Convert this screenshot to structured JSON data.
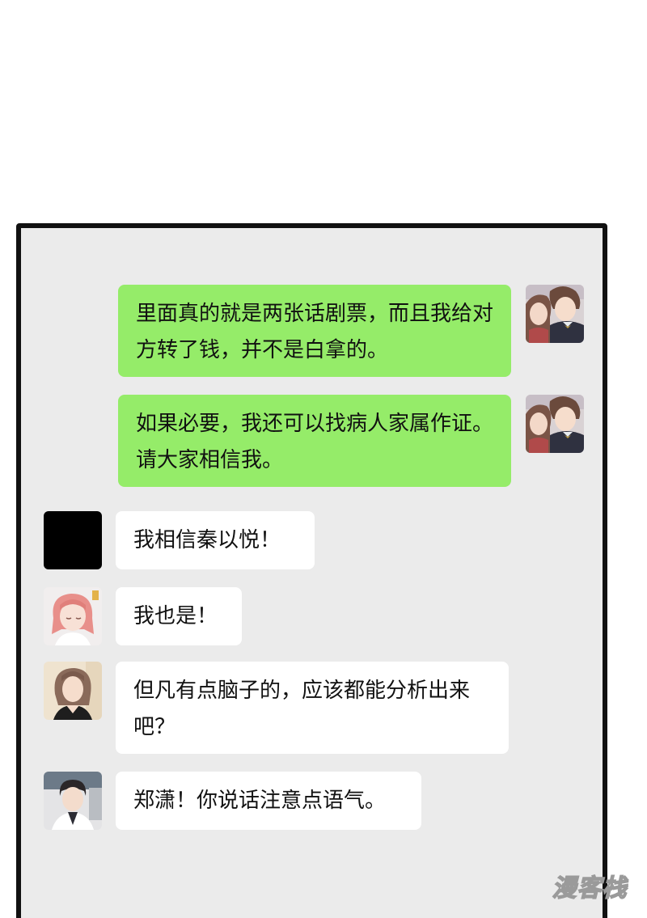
{
  "messages": [
    {
      "side": "right",
      "avatar": "couple-avatar",
      "text": "里面真的就是两张话剧票，而且我给对方转了钱，并不是白拿的。"
    },
    {
      "side": "right",
      "avatar": "couple-avatar",
      "text": "如果必要，我还可以找病人家属作证。请大家相信我。"
    },
    {
      "side": "left",
      "avatar": "black-avatar",
      "text": "我相信秦以悦！"
    },
    {
      "side": "left",
      "avatar": "pink-hair-girl-avatar",
      "text": "我也是！"
    },
    {
      "side": "left",
      "avatar": "brown-hair-woman-avatar",
      "text": "但凡有点脑子的，应该都能分析出来吧？"
    },
    {
      "side": "left",
      "avatar": "doctor-man-avatar",
      "text": "郑潇！你说话注意点语气。"
    }
  ],
  "watermark": {
    "text": "漫客栈"
  },
  "colors": {
    "sent_bubble": "#95ec69",
    "received_bubble": "#ffffff",
    "chat_background": "#ebebeb",
    "frame_border": "#111111"
  }
}
